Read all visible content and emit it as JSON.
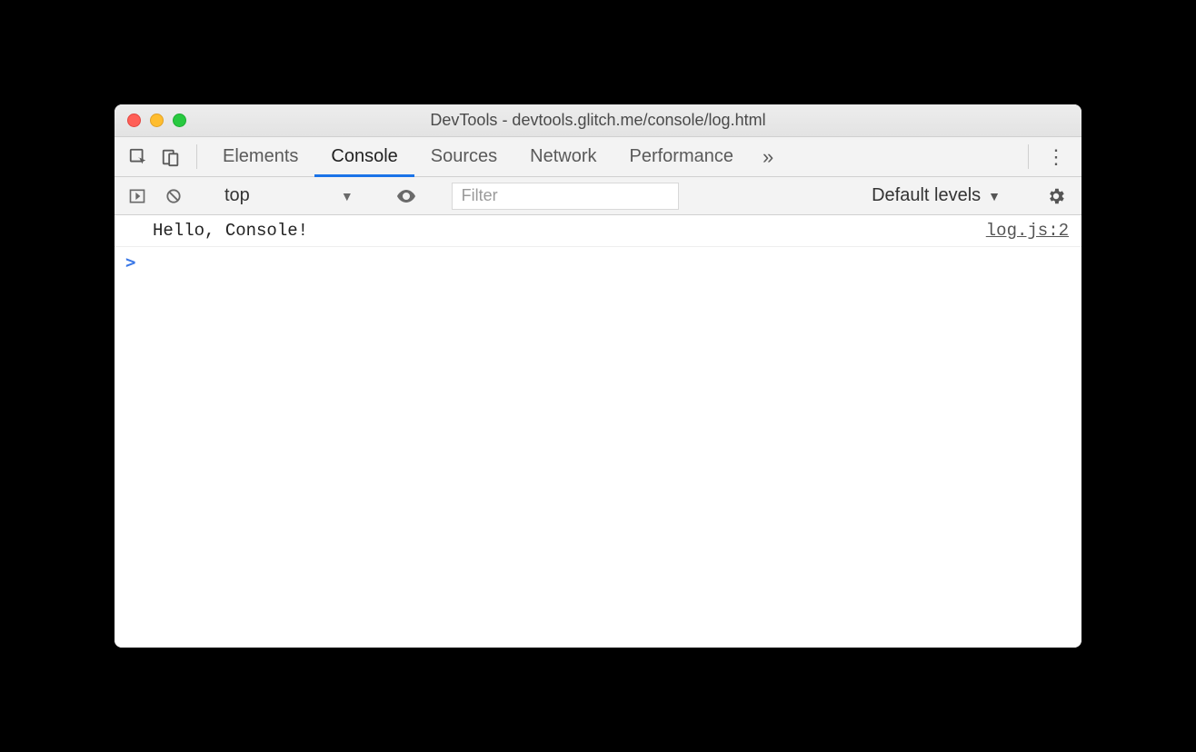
{
  "window": {
    "title": "DevTools - devtools.glitch.me/console/log.html"
  },
  "tabs": {
    "items": [
      "Elements",
      "Console",
      "Sources",
      "Network",
      "Performance"
    ],
    "active": "Console"
  },
  "toolbar": {
    "context": "top",
    "filter_placeholder": "Filter",
    "levels_label": "Default levels"
  },
  "console": {
    "rows": [
      {
        "text": "Hello, Console!",
        "source": "log.js:2"
      }
    ],
    "prompt": ">"
  }
}
